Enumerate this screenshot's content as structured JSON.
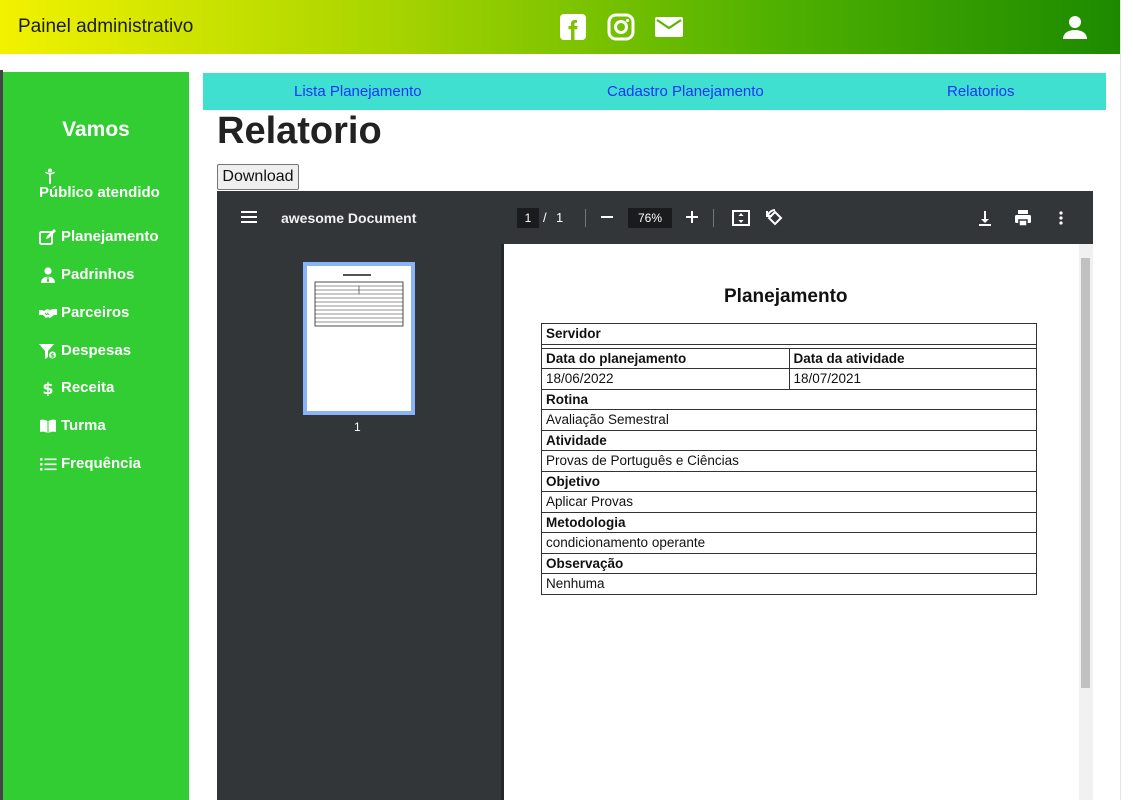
{
  "header": {
    "brand": "Painel administrativo",
    "icons": [
      "facebook-icon",
      "instagram-icon",
      "mail-icon"
    ],
    "user_icon": "user-icon"
  },
  "sidebar": {
    "title": "Vamos",
    "items": [
      {
        "label": "Público atendido",
        "icon": "person-icon"
      },
      {
        "label": "Planejamento",
        "icon": "edit-icon"
      },
      {
        "label": "Padrinhos",
        "icon": "user-tie-icon"
      },
      {
        "label": "Parceiros",
        "icon": "handshake-icon"
      },
      {
        "label": "Despesas",
        "icon": "funnel-dollar-icon"
      },
      {
        "label": "Receita",
        "icon": "dollar-icon"
      },
      {
        "label": "Turma",
        "icon": "book-icon"
      },
      {
        "label": "Frequência",
        "icon": "list-icon"
      }
    ]
  },
  "tabs": [
    "Lista Planejamento",
    "Cadastro Planejamento",
    "Relatorios"
  ],
  "page": {
    "heading": "Relatorio",
    "download_label": "Download"
  },
  "viewer": {
    "doc_title": "awesome Document",
    "current_page": "1",
    "page_sep": "/",
    "total_pages": "1",
    "zoom": "76%",
    "thumb_label": "1"
  },
  "pdf": {
    "title": "Planejamento",
    "servidor_label": "Servidor",
    "data_planejamento_label": "Data do planejamento",
    "data_atividade_label": "Data da atividade",
    "data_planejamento": "18/06/2022",
    "data_atividade": "18/07/2021",
    "rotina_label": "Rotina",
    "rotina": "Avaliação Semestral",
    "atividade_label": "Atividade",
    "atividade": "Provas de Português e Ciências",
    "objetivo_label": "Objetivo",
    "objetivo": "Aplicar Provas",
    "metodologia_label": "Metodologia",
    "metodologia": "condicionamento operante",
    "observacao_label": "Observação",
    "observacao": "Nenhuma"
  },
  "colors": {
    "sidebar": "#32cd32",
    "tabbar": "#40e0d0",
    "tab_link": "#1a33ff",
    "viewer_toolbar": "#323639"
  }
}
